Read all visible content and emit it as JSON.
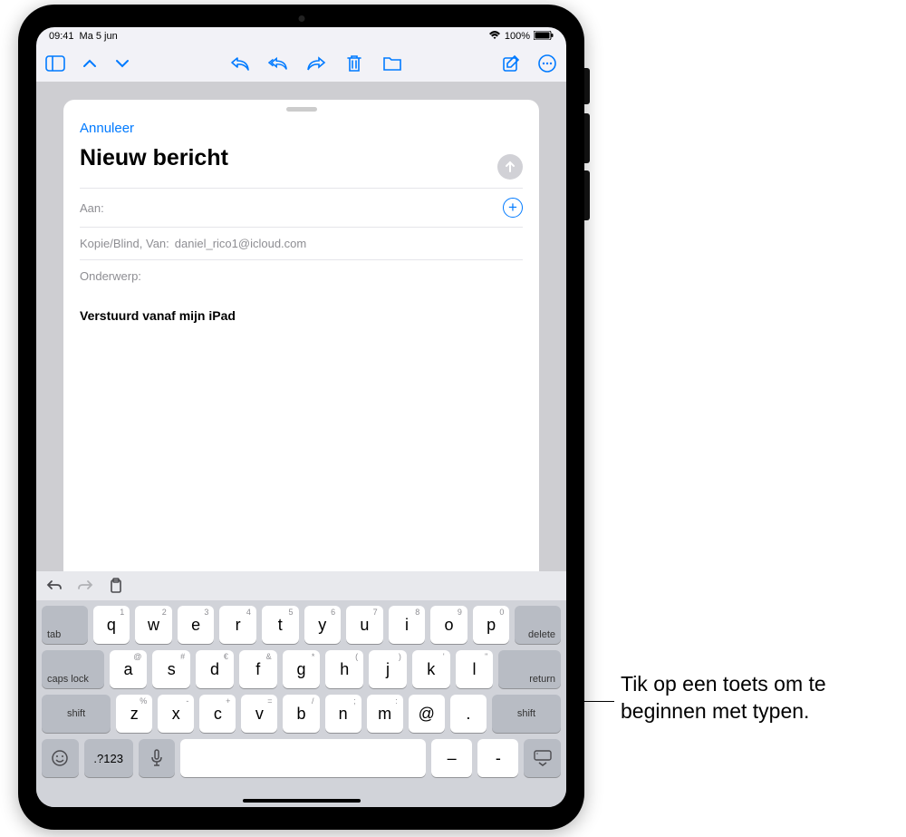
{
  "status": {
    "time": "09:41",
    "date": "Ma 5 jun",
    "battery": "100%"
  },
  "compose": {
    "cancel": "Annuleer",
    "title": "Nieuw bericht",
    "to_label": "Aan:",
    "cc_label": "Kopie/Blind, Van:",
    "cc_value": "daniel_rico1@icloud.com",
    "subject_label": "Onderwerp:",
    "body": "Verstuurd vanaf mijn iPad"
  },
  "keyboard": {
    "row1": [
      {
        "main": "q",
        "alt": "1"
      },
      {
        "main": "w",
        "alt": "2"
      },
      {
        "main": "e",
        "alt": "3"
      },
      {
        "main": "r",
        "alt": "4"
      },
      {
        "main": "t",
        "alt": "5"
      },
      {
        "main": "y",
        "alt": "6"
      },
      {
        "main": "u",
        "alt": "7"
      },
      {
        "main": "i",
        "alt": "8"
      },
      {
        "main": "o",
        "alt": "9"
      },
      {
        "main": "p",
        "alt": "0"
      }
    ],
    "row2": [
      {
        "main": "a",
        "alt": "@"
      },
      {
        "main": "s",
        "alt": "#"
      },
      {
        "main": "d",
        "alt": "€"
      },
      {
        "main": "f",
        "alt": "&"
      },
      {
        "main": "g",
        "alt": "*"
      },
      {
        "main": "h",
        "alt": "("
      },
      {
        "main": "j",
        "alt": ")"
      },
      {
        "main": "k",
        "alt": "'"
      },
      {
        "main": "l",
        "alt": "\""
      }
    ],
    "row3": [
      {
        "main": "z",
        "alt": "%"
      },
      {
        "main": "x",
        "alt": "-"
      },
      {
        "main": "c",
        "alt": "+"
      },
      {
        "main": "v",
        "alt": "="
      },
      {
        "main": "b",
        "alt": "/"
      },
      {
        "main": "n",
        "alt": ";"
      },
      {
        "main": "m",
        "alt": ":"
      },
      {
        "main": "@",
        "alt": ""
      },
      {
        "main": ".",
        "alt": ""
      }
    ],
    "tab": "tab",
    "delete": "delete",
    "caps": "caps lock",
    "return": "return",
    "shift": "shift",
    "numswitch": ".?123",
    "dash": "–",
    "hyphen": "-"
  },
  "callout": "Tik op een toets om te beginnen met typen."
}
